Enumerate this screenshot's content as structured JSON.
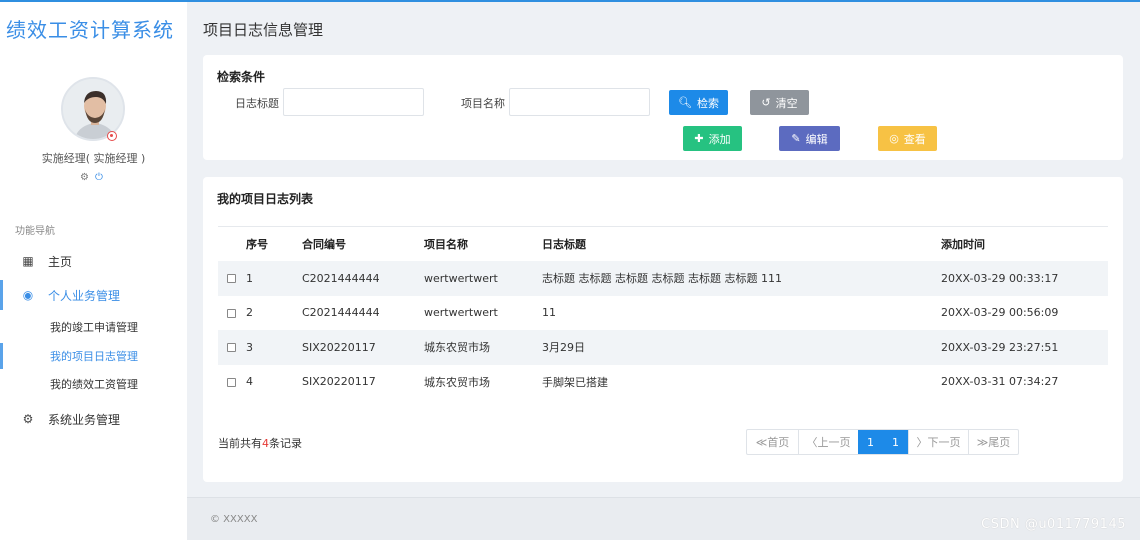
{
  "app": {
    "title": "绩效工资计算系统"
  },
  "user": {
    "role_label": "实施经理( 实施经理 )"
  },
  "icons": {
    "settings": "gear-icon",
    "power": "power-icon"
  },
  "colors": {
    "accent": "#1d8ae8",
    "search_btn": "#1d8ae8",
    "clear_btn": "#8f959c",
    "add_btn": "#26c281",
    "edit_btn": "#5c6bc0",
    "view_btn": "#f7c244",
    "total_count": "#e53935"
  },
  "sidebar": {
    "nav_title": "功能导航",
    "items": [
      {
        "label": "主页",
        "icon": "grid-icon"
      },
      {
        "label": "个人业务管理",
        "icon": "user-circle-icon",
        "active": true,
        "children": [
          {
            "label": "我的竣工申请管理"
          },
          {
            "label": "我的项目日志管理",
            "active": true
          },
          {
            "label": "我的绩效工资管理"
          }
        ]
      },
      {
        "label": "系统业务管理",
        "icon": "cogs-icon"
      }
    ]
  },
  "page": {
    "title": "项目日志信息管理"
  },
  "search": {
    "title": "检索条件",
    "field1_label": "日志标题",
    "field1_value": "",
    "field2_label": "项目名称",
    "field2_value": "",
    "search_label": "检索",
    "clear_label": "清空",
    "add_label": "添加",
    "edit_label": "编辑",
    "view_label": "查看"
  },
  "list": {
    "title": "我的项目日志列表",
    "columns": [
      "序号",
      "合同编号",
      "项目名称",
      "日志标题",
      "添加时间"
    ],
    "rows": [
      {
        "no": "1",
        "contract": "C2021444444",
        "project": "wertwertwert",
        "log_title": "志标题 志标题 志标题 志标题 志标题 志标题 111",
        "time": "20XX-03-29 00:33:17"
      },
      {
        "no": "2",
        "contract": "C2021444444",
        "project": "wertwertwert",
        "log_title": "11",
        "time": "20XX-03-29 00:56:09"
      },
      {
        "no": "3",
        "contract": "SIX20220117",
        "project": "城东农贸市场",
        "log_title": "3月29日",
        "time": "20XX-03-29 23:27:51"
      },
      {
        "no": "4",
        "contract": "SIX20220117",
        "project": "城东农贸市场",
        "log_title": "手脚架已搭建",
        "time": "20XX-03-31 07:34:27"
      }
    ],
    "total_prefix": "当前共有",
    "total_count": "4",
    "total_suffix": "条记录"
  },
  "pager": {
    "first": "≪首页",
    "prev": "〈上一页",
    "page_a": "1",
    "page_b": "1",
    "next": "〉下一页",
    "last": "≫尾页"
  },
  "footer": {
    "copyright": "© XXXXX",
    "watermark": "CSDN @u011779145"
  }
}
